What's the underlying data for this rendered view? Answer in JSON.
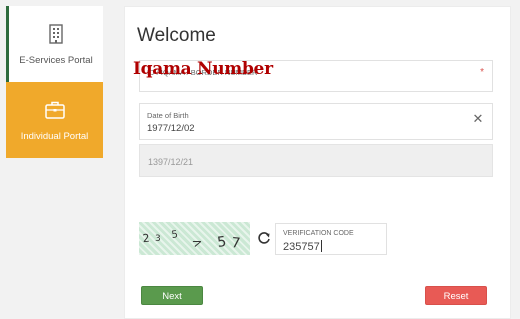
{
  "sidebar": {
    "items": [
      {
        "label": "E-Services Portal",
        "icon": "building-icon"
      },
      {
        "label": "Individual Portal",
        "icon": "briefcase-icon"
      }
    ]
  },
  "main": {
    "title": "Welcome",
    "id_field": {
      "label": "ID / IQAMA / BORDER NUMBER",
      "required_mark": "*",
      "value": ""
    },
    "annotation": "Iqama Number",
    "dob_field": {
      "label": "Date of Birth",
      "value": "1977/12/02"
    },
    "hijri_field": {
      "value": "1397/12/21"
    },
    "captcha": {
      "text": "235 > 57"
    },
    "verification_field": {
      "label": "VERIFICATION CODE",
      "value": "235757"
    },
    "buttons": {
      "next": "Next",
      "reset": "Reset"
    }
  },
  "colors": {
    "individual_accent": "#f0a92b",
    "next_button": "#5a9a4d",
    "reset_button": "#e85a55",
    "annotation": "#b00000"
  }
}
